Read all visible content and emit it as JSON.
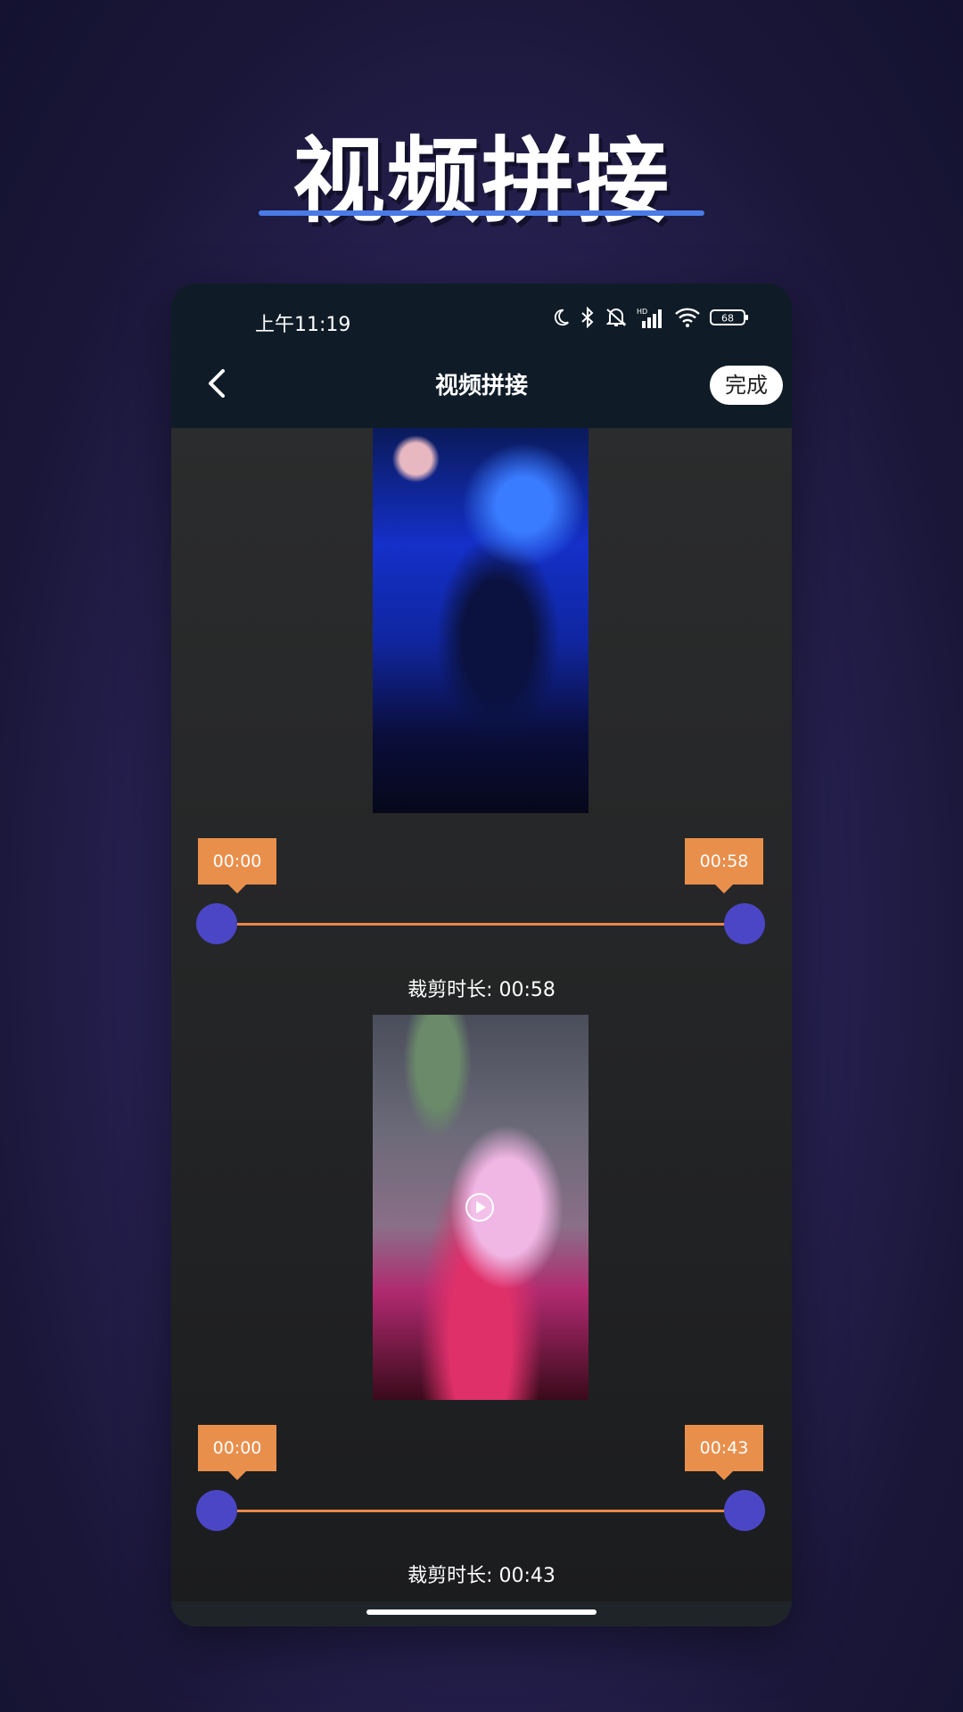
{
  "hero": {
    "title": "视频拼接"
  },
  "status_bar": {
    "time": "上午11:19",
    "battery": "68",
    "icons": [
      "moon-icon",
      "bluetooth-icon",
      "mute-icon",
      "hd-signal-icon",
      "wifi-icon",
      "battery-icon"
    ]
  },
  "nav": {
    "title": "视频拼接",
    "done_label": "完成",
    "back_icon": "chevron-left-icon"
  },
  "clips": [
    {
      "start_label": "00:00",
      "end_label": "00:58",
      "duration_label": "裁剪时长: 00:58",
      "start_fraction": 0.0,
      "end_fraction": 1.0
    },
    {
      "start_label": "00:00",
      "end_label": "00:43",
      "duration_label": "裁剪时长: 00:43",
      "start_fraction": 0.0,
      "end_fraction": 1.0,
      "play_icon": "play-icon"
    }
  ],
  "colors": {
    "accent_orange": "#e98f4c",
    "knob_purple": "#4b46c6",
    "topbar": "#0f1c27",
    "underline_blue": "#4a7be6"
  }
}
